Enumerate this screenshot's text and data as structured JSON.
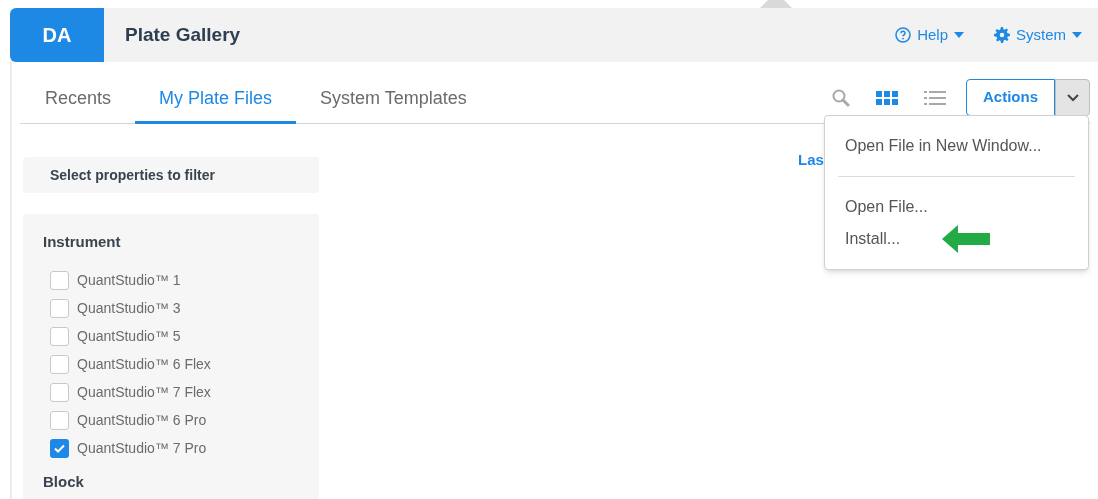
{
  "header": {
    "logo": "DA",
    "title": "Plate Gallery",
    "menus": [
      {
        "kind": "help",
        "label": "Help"
      },
      {
        "kind": "system",
        "label": "System"
      }
    ]
  },
  "tabs": [
    {
      "label": "Recents",
      "selected": false
    },
    {
      "label": "My Plate Files",
      "selected": true
    },
    {
      "label": "System Templates",
      "selected": false
    }
  ],
  "toolbar": {
    "views": [
      {
        "kind": "grid",
        "selected": true
      },
      {
        "kind": "list",
        "selected": false
      }
    ],
    "actions_button": "Actions"
  },
  "actions_menu": [
    {
      "kind": "item",
      "label": "Open File in New Window..."
    },
    {
      "kind": "divider"
    },
    {
      "kind": "item",
      "label": "Open File..."
    },
    {
      "kind": "item",
      "label": "Install...",
      "pointer": true
    }
  ],
  "sort_label": "Las",
  "filter": {
    "title": "Select properties to filter",
    "groups": [
      {
        "title": "Instrument",
        "options": [
          {
            "label": "QuantStudio™ 1",
            "checked": false
          },
          {
            "label": "QuantStudio™ 3",
            "checked": false
          },
          {
            "label": "QuantStudio™ 5",
            "checked": false
          },
          {
            "label": "QuantStudio™ 6 Flex",
            "checked": false
          },
          {
            "label": "QuantStudio™ 7 Flex",
            "checked": false
          },
          {
            "label": "QuantStudio™ 6 Pro",
            "checked": false
          },
          {
            "label": "QuantStudio™ 7 Pro",
            "checked": true
          }
        ]
      },
      {
        "title": "Block"
      }
    ]
  }
}
